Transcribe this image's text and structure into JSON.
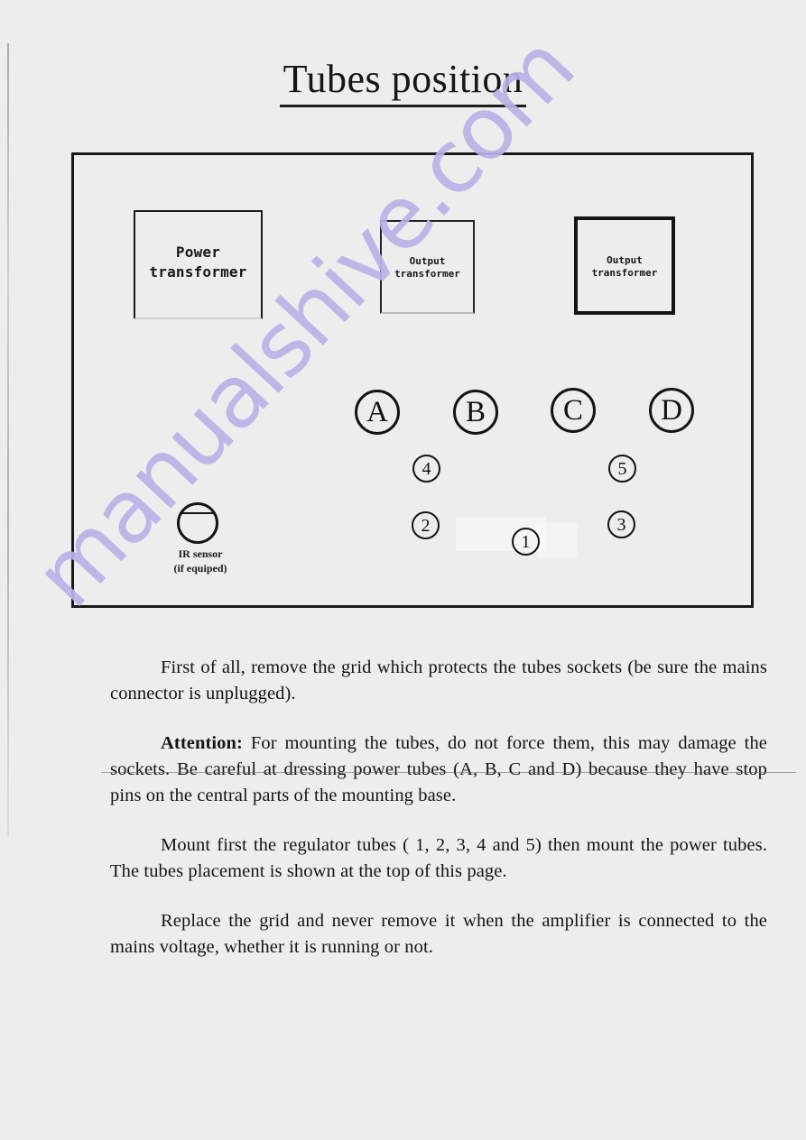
{
  "document": {
    "title": "Tubes position",
    "watermark": "manualshive.com",
    "watermark_color": "#b7b3e6",
    "page_background": "#eceded",
    "ink_color": "#141416"
  },
  "diagram": {
    "name": "tubes-position-layout",
    "transformers": [
      {
        "id": "power",
        "label": "Power\ntransformer"
      },
      {
        "id": "output1",
        "label": "Output\ntransformer"
      },
      {
        "id": "output2",
        "label": "Output\ntransformer"
      }
    ],
    "power_tubes": [
      {
        "id": "A",
        "label": "A"
      },
      {
        "id": "B",
        "label": "B"
      },
      {
        "id": "C",
        "label": "C"
      },
      {
        "id": "D",
        "label": "D"
      }
    ],
    "regulator_tubes": [
      {
        "id": "4",
        "label": "4"
      },
      {
        "id": "5",
        "label": "5"
      },
      {
        "id": "2",
        "label": "2"
      },
      {
        "id": "1",
        "label": "1"
      },
      {
        "id": "3",
        "label": "3"
      }
    ],
    "ir_sensor": {
      "label": "IR sensor\n(if equiped)"
    }
  },
  "paragraphs": {
    "p1": "First of all, remove the grid which protects the tubes sockets (be sure the mains connector is unplugged).",
    "p2_lead": "Attention:",
    "p2_rest": " For mounting the tubes, do not force them, this may damage the sockets. Be careful at dressing power tubes (A, B, C and D) because they have stop pins on the central parts of the mounting base.",
    "p3": "Mount first the regulator tubes ( 1, 2, 3, 4 and 5) then mount the power tubes. The tubes placement is shown at the top of this page.",
    "p4": "Replace the grid and never remove it when the amplifier is connected to the mains voltage, whether it is running or not."
  }
}
